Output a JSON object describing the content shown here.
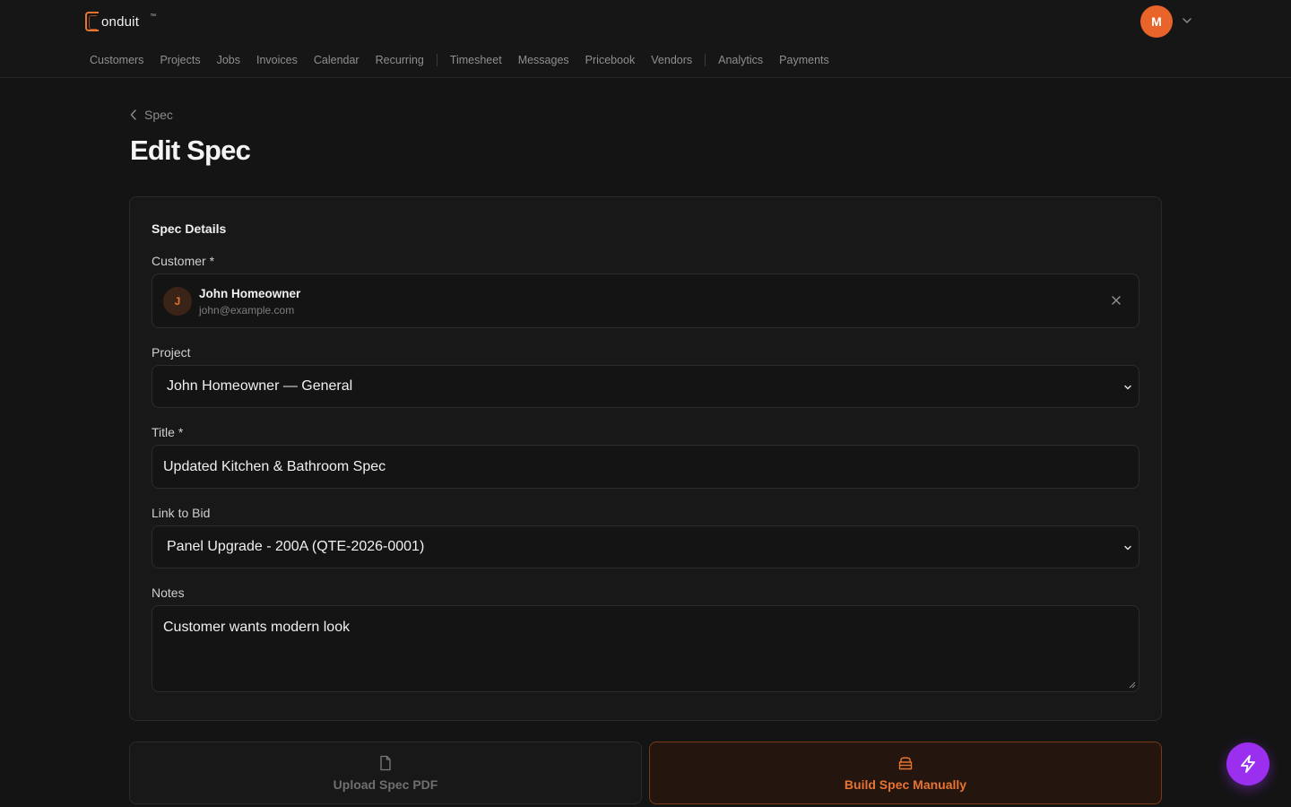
{
  "app": {
    "logo_text": "onduit",
    "logo_tm": "™",
    "user_initial": "M",
    "accent_color": "#e8742f"
  },
  "nav": {
    "items": [
      "Customers",
      "Projects",
      "Jobs",
      "Invoices",
      "Calendar",
      "Recurring",
      "Timesheet",
      "Messages",
      "Pricebook",
      "Vendors",
      "Analytics",
      "Payments"
    ]
  },
  "page": {
    "breadcrumb": "Spec",
    "title": "Edit Spec"
  },
  "form": {
    "section_title": "Spec Details",
    "customer": {
      "label": "Customer *",
      "initial": "J",
      "name": "John Homeowner",
      "email": "john@example.com"
    },
    "project": {
      "label": "Project",
      "value": "John Homeowner — General"
    },
    "title": {
      "label": "Title *",
      "value": "Updated Kitchen & Bathroom Spec"
    },
    "bid": {
      "label": "Link to Bid",
      "value": "Panel Upgrade - 200A (QTE-2026-0001)"
    },
    "notes": {
      "label": "Notes",
      "value": "Customer wants modern look"
    }
  },
  "actions": {
    "upload_label": "Upload Spec PDF",
    "build_label": "Build Spec Manually"
  }
}
